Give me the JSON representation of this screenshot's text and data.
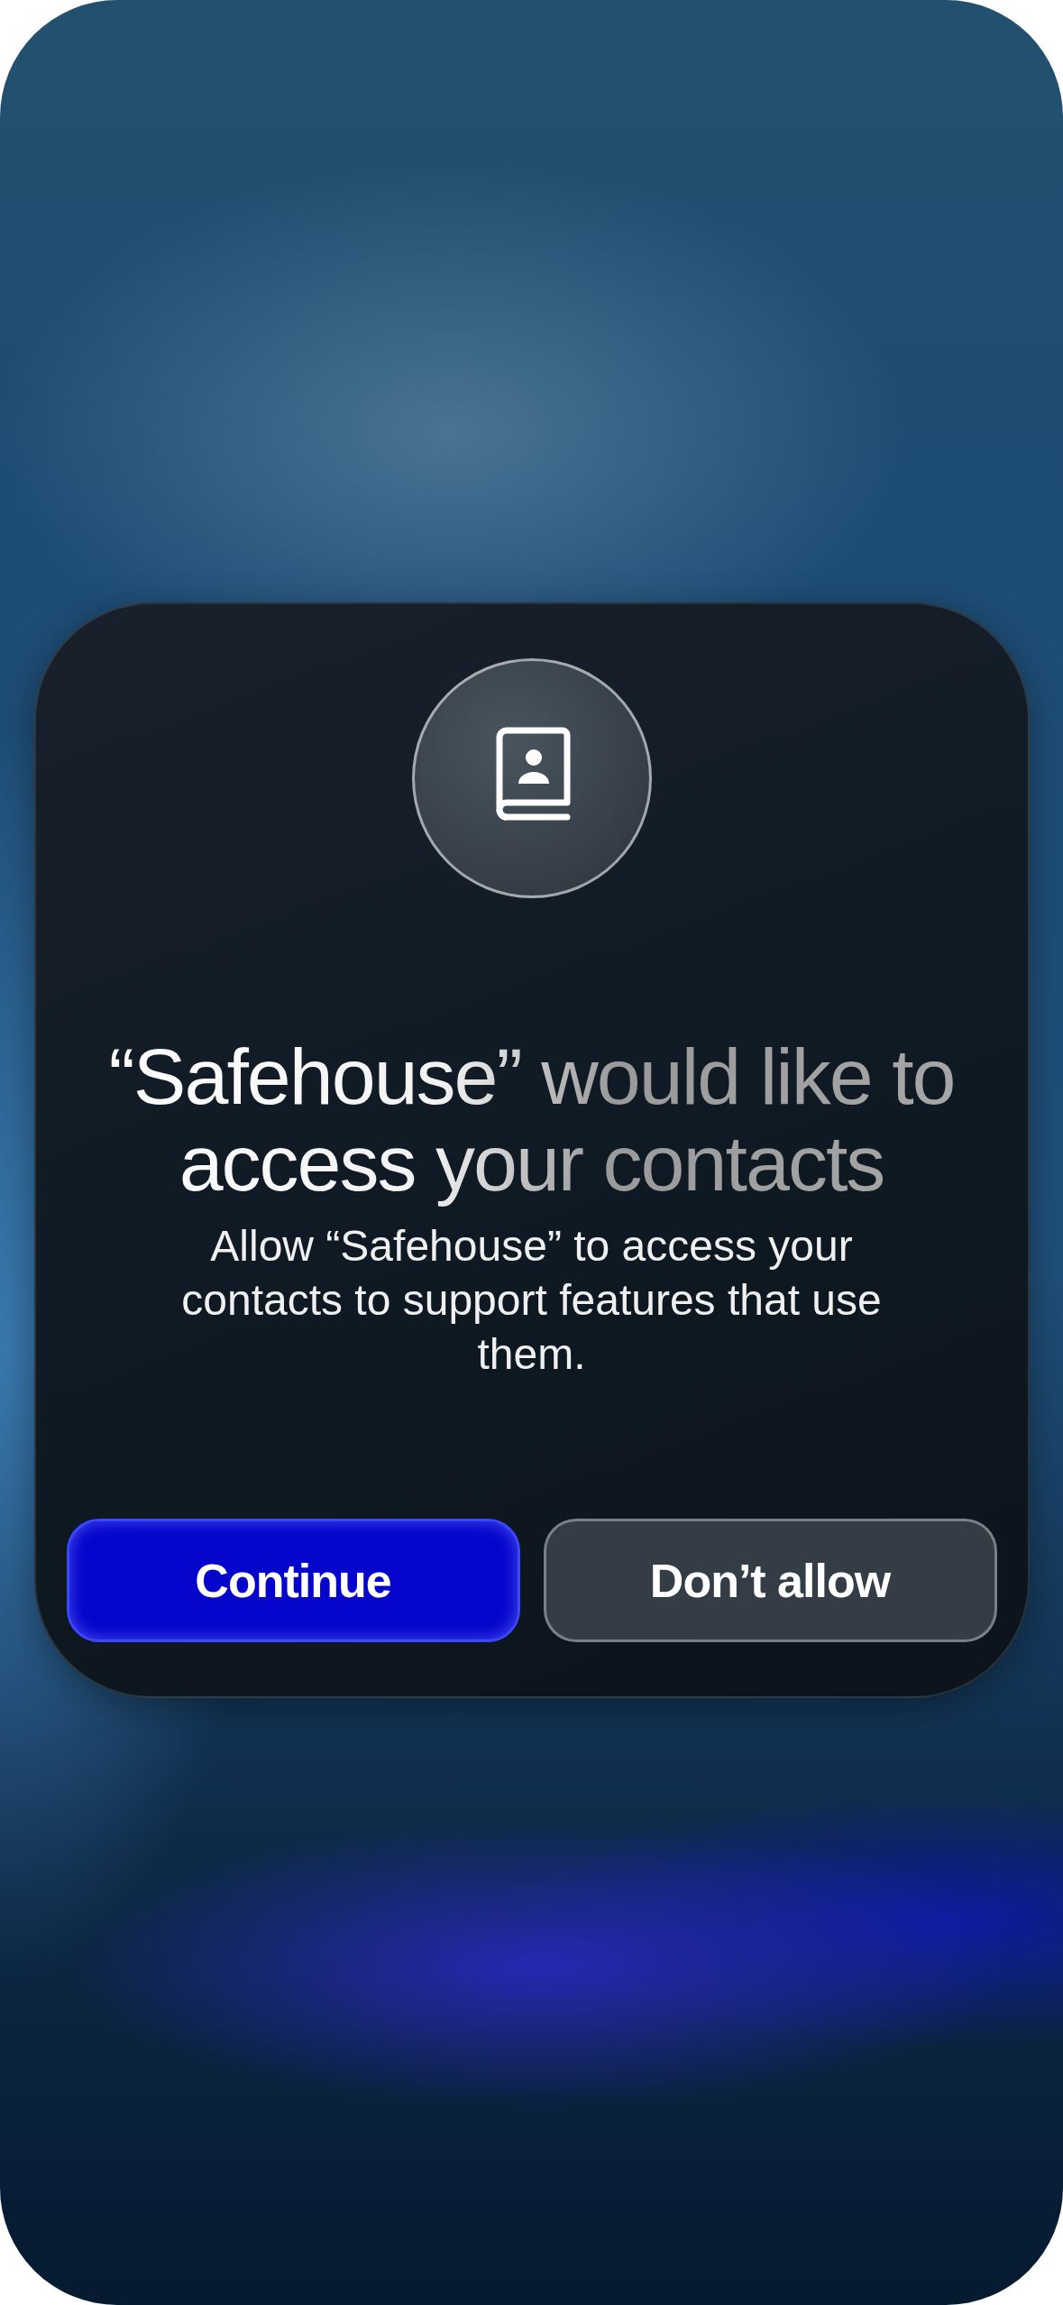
{
  "dialog": {
    "title": "“Safehouse” would like to access your contacts",
    "message": "Allow “Safehouse” to access your contacts to support features that use them.",
    "buttons": [
      {
        "label": "Continue",
        "kind": "primary"
      },
      {
        "label": "Don’t allow",
        "kind": "secondary"
      }
    ]
  }
}
